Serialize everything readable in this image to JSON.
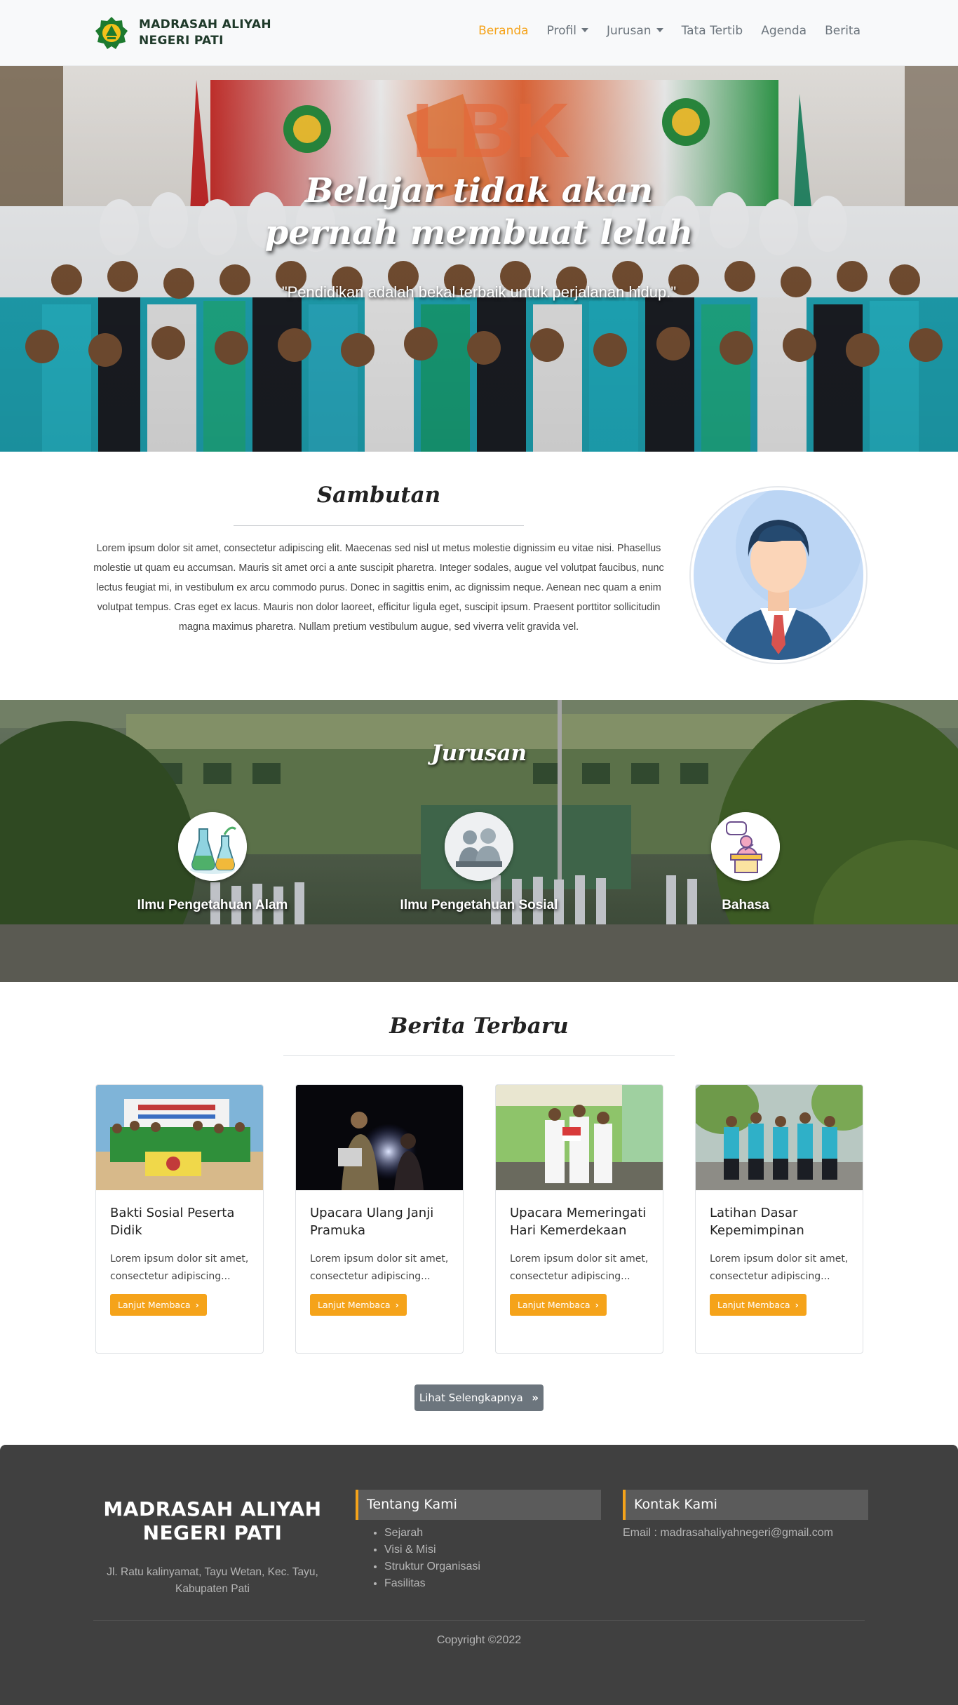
{
  "brand": {
    "name_line1": "MADRASAH ALIYAH",
    "name_line2": "NEGERI PATI"
  },
  "nav": {
    "items": [
      {
        "label": "Beranda",
        "active": true
      },
      {
        "label": "Profil",
        "dropdown": true
      },
      {
        "label": "Jurusan",
        "dropdown": true
      },
      {
        "label": "Tata Tertib"
      },
      {
        "label": "Agenda"
      },
      {
        "label": "Berita"
      }
    ]
  },
  "hero": {
    "title": "Belajar tidak akan pernah membuat lelah",
    "subtitle": "\"Pendidikan adalah bekal terbaik untuk perjalanan hidup.\"",
    "banner_text": "LBK"
  },
  "sambutan": {
    "title": "Sambutan",
    "text": "Lorem ipsum dolor sit amet, consectetur adipiscing elit. Maecenas sed nisl ut metus molestie dignissim eu vitae nisi. Phasellus molestie ut quam eu accumsan. Mauris sit amet orci a ante suscipit pharetra. Integer sodales, augue vel volutpat faucibus, nunc lectus feugiat mi, in vestibulum ex arcu commodo purus. Donec in sagittis enim, ac dignissim neque. Aenean nec quam a enim volutpat tempus. Cras eget ex lacus. Mauris non dolor laoreet, efficitur ligula eget, suscipit ipsum. Praesent porttitor sollicitudin magna maximus pharetra. Nullam pretium vestibulum augue, sed viverra velit gravida vel."
  },
  "jurusan": {
    "title": "Jurusan",
    "items": [
      {
        "label": "Ilmu Pengetahuan Alam",
        "icon": "chemistry-flask-icon"
      },
      {
        "label": "Ilmu Pengetahuan Sosial",
        "icon": "people-icon"
      },
      {
        "label": "Bahasa",
        "icon": "speaker-podium-icon"
      }
    ]
  },
  "berita": {
    "title": "Berita Terbaru",
    "read_more": "Lanjut Membaca",
    "more_button": "Lihat Selengkapnya",
    "cards": [
      {
        "title": "Bakti Sosial Peserta Didik",
        "excerpt": "Lorem ipsum dolor sit amet, consectetur adipiscing..."
      },
      {
        "title": "Upacara Ulang Janji Pramuka",
        "excerpt": "Lorem ipsum dolor sit amet, consectetur adipiscing..."
      },
      {
        "title": "Upacara Memeringati Hari Kemerdekaan",
        "excerpt": "Lorem ipsum dolor sit amet, consectetur adipiscing..."
      },
      {
        "title": "Latihan Dasar Kepemimpinan",
        "excerpt": "Lorem ipsum dolor sit amet, consectetur adipiscing..."
      }
    ]
  },
  "footer": {
    "brand_line1": "MADRASAH ALIYAH",
    "brand_line2": "NEGERI PATI",
    "address": "Jl. Ratu kalinyamat, Tayu Wetan, Kec. Tayu, Kabupaten Pati",
    "about_title": "Tentang Kami",
    "about_links": [
      "Sejarah",
      "Visi & Misi",
      "Struktur Organisasi",
      "Fasilitas"
    ],
    "contact_title": "Kontak Kami",
    "email": "Email : madrasahaliyahnegeri@gmail.com",
    "copyright": "Copyright ©2022"
  },
  "colors": {
    "accent": "#f5a31a",
    "footer_bg": "#404040",
    "nav_bg": "#f8f9fa",
    "secondary": "#6c757d"
  }
}
